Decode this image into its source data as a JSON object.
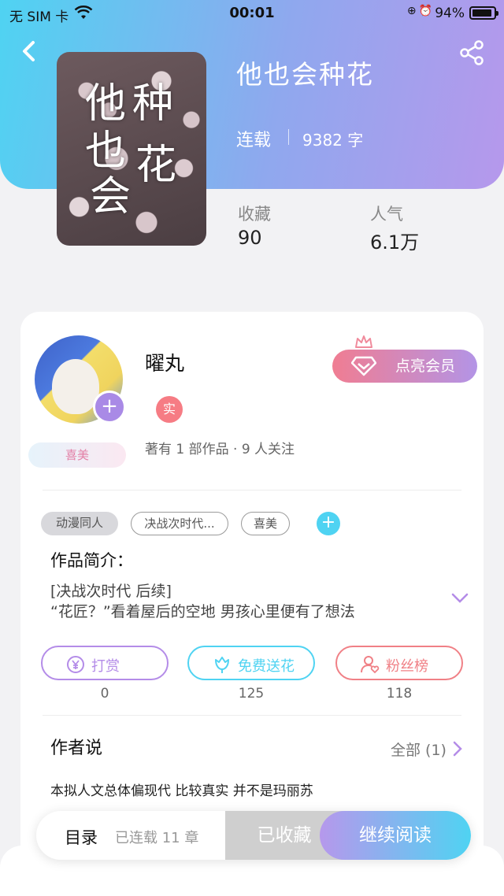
{
  "status_bar": {
    "carrier": "无 SIM 卡",
    "time": "00:01",
    "battery_percent": "94%",
    "battery_level": 0.94
  },
  "book": {
    "cover_text": [
      "他",
      "也",
      "会",
      "种",
      "花"
    ],
    "title": "他也会种花",
    "status": "连载",
    "word_count": "9382 字",
    "stats": {
      "favorites_label": "收藏",
      "favorites_value": "90",
      "popularity_label": "人气",
      "popularity_value": "6.1万"
    }
  },
  "author": {
    "name": "曜丸",
    "verified_badge": "实",
    "level_badge": "喜美",
    "stats_text": "著有 1 部作品 · 9 人关注",
    "vip_button": "点亮会员"
  },
  "tags": [
    "动漫同人",
    "决战次时代...",
    "喜美"
  ],
  "intro": {
    "title": "作品简介：",
    "line1": "[决战次时代 后续]",
    "line2": "“花匠？”看着屋后的空地 男孩心里便有了想法"
  },
  "actions": {
    "tip": {
      "label": "打赏",
      "count": "0"
    },
    "flower": {
      "label": "免费送花",
      "count": "125"
    },
    "fans": {
      "label": "粉丝榜",
      "count": "118"
    }
  },
  "author_says": {
    "title": "作者说",
    "all_label": "全部 (1)",
    "text": "本拟人文总体偏现代 比较真实 并不是玛丽苏"
  },
  "bottom_bar": {
    "toc_label": "目录",
    "chapter_status": "已连载 11 章",
    "collected_label": "已收藏",
    "continue_label": "继续阅读"
  },
  "colors": {
    "gradient_start": "#4fd3f2",
    "gradient_end": "#b698ec",
    "tip_color": "#b48ce8",
    "flower_color": "#4fd3f2",
    "fans_color": "#f08086"
  }
}
